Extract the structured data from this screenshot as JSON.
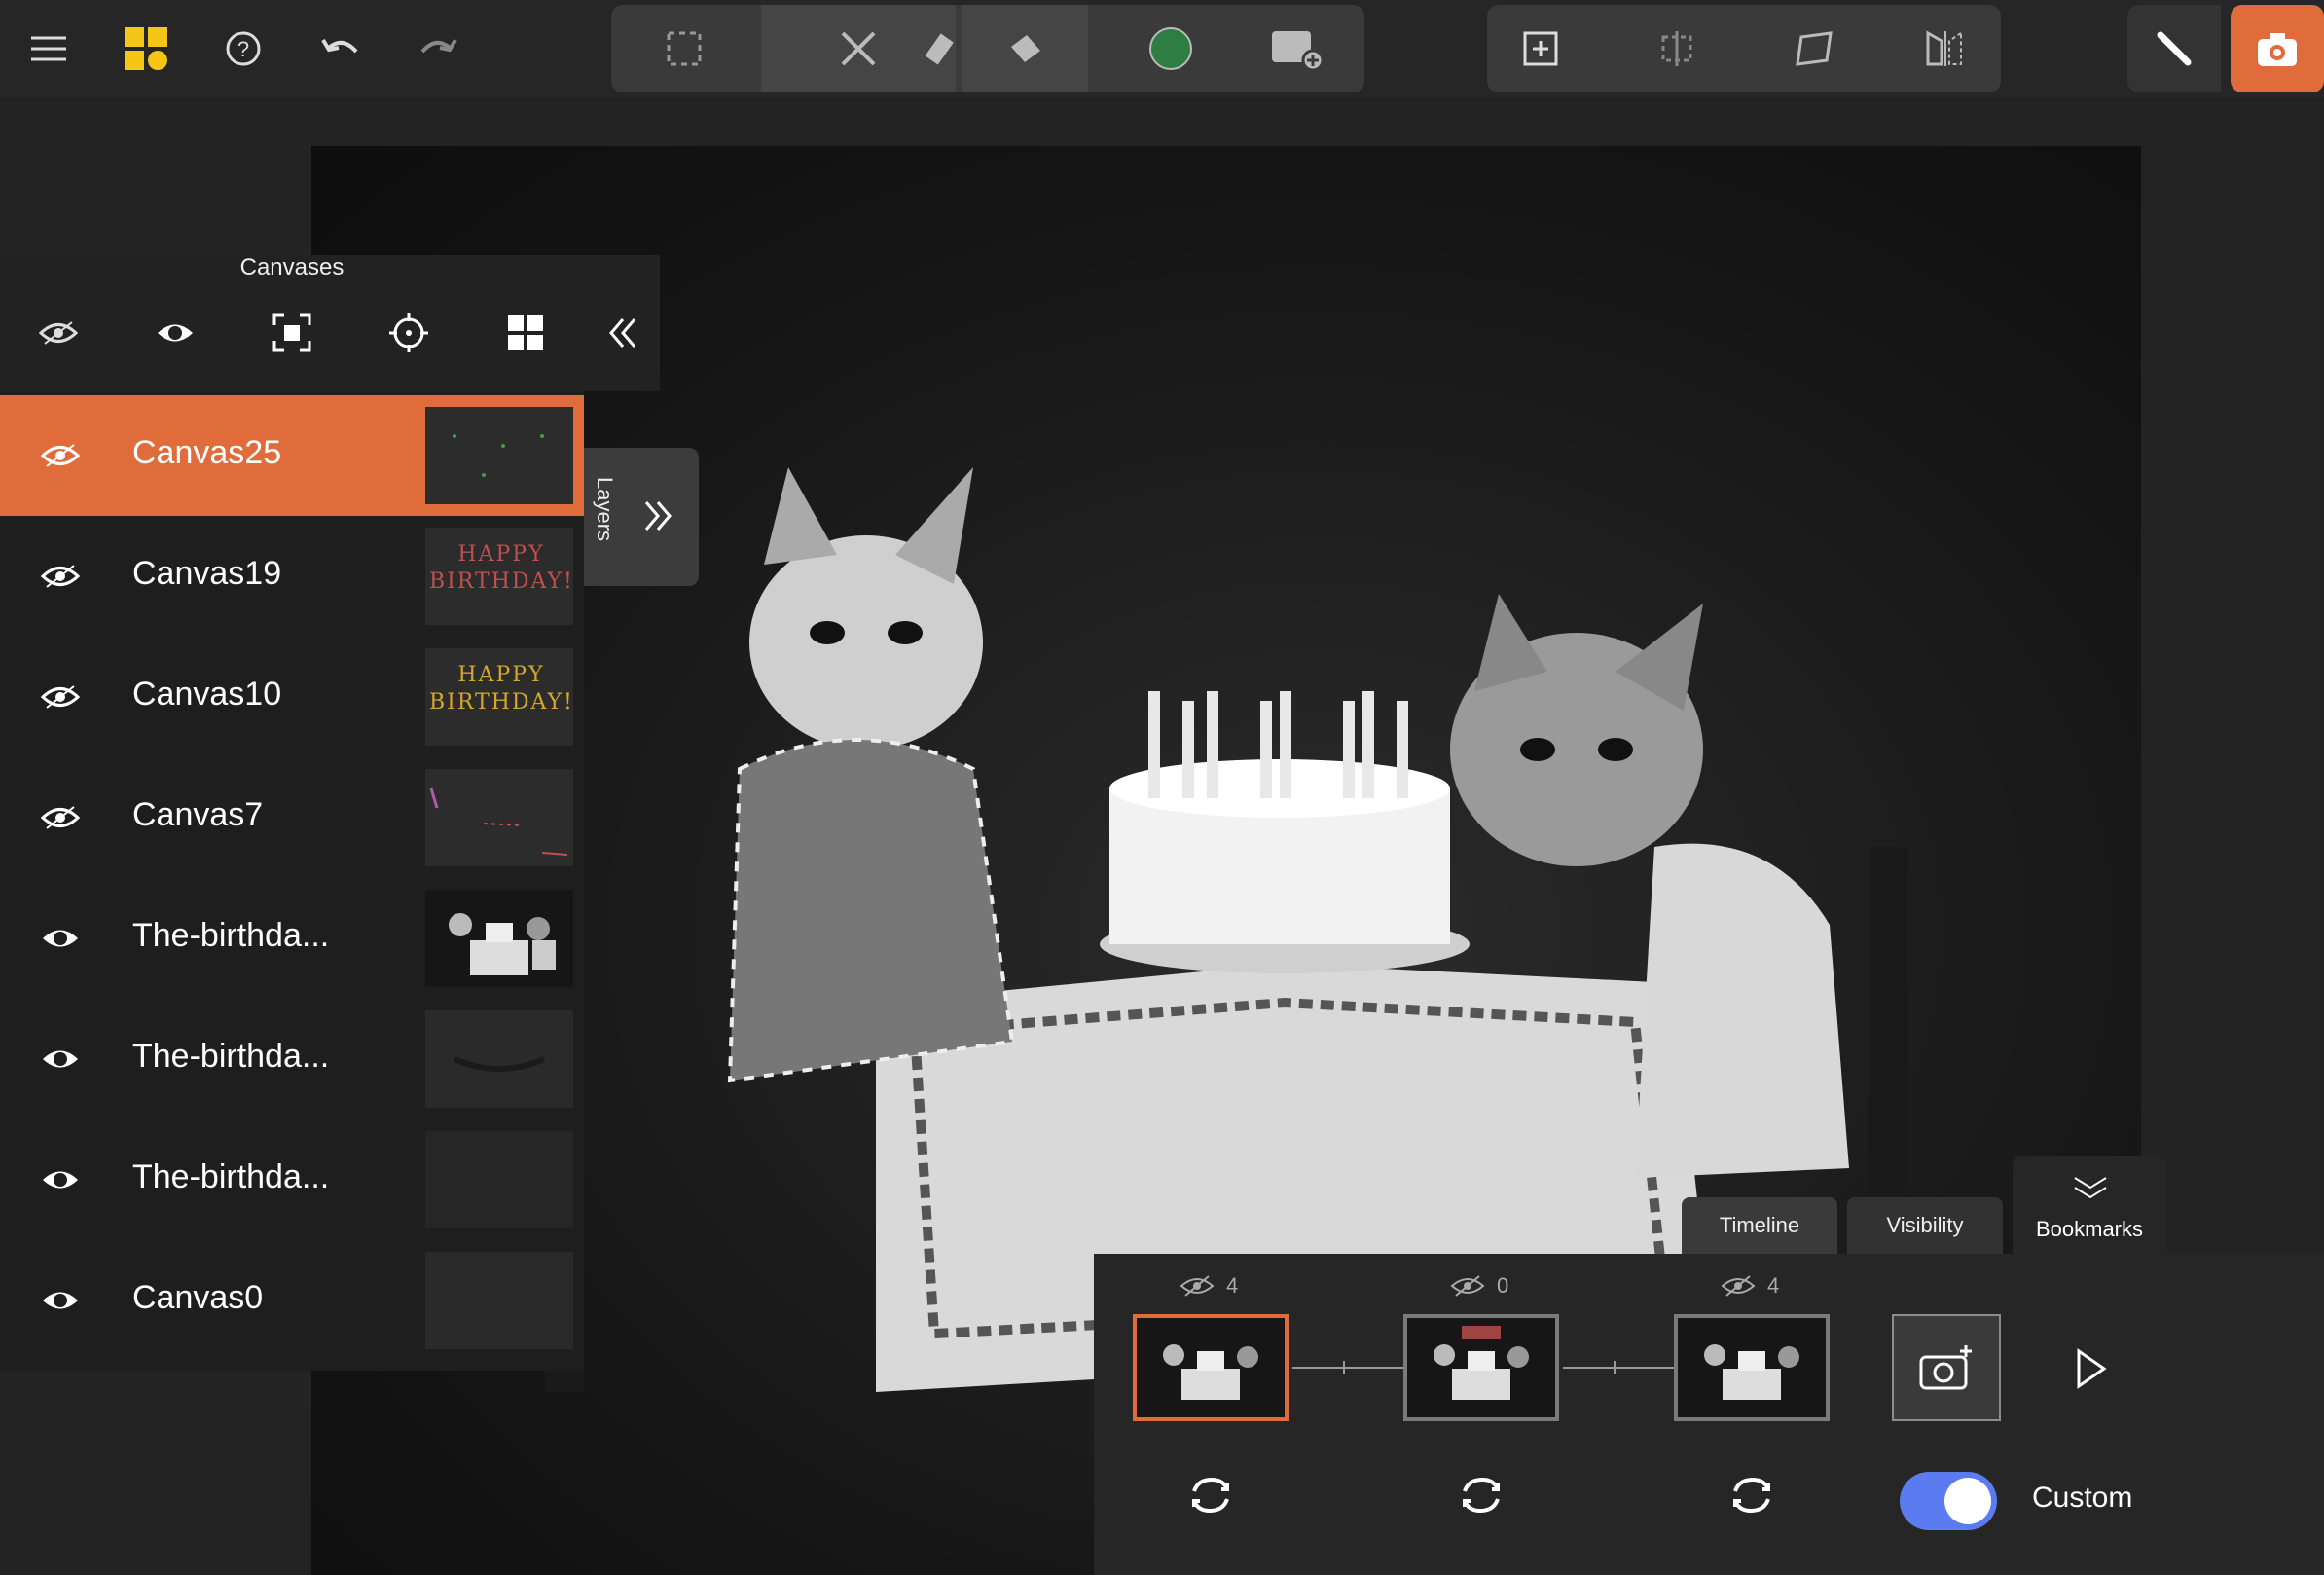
{
  "topbar": {
    "left_icons": [
      "menu-icon",
      "app-logo-icon",
      "help-icon",
      "undo-icon",
      "redo-icon"
    ],
    "tools": [
      "selection-icon",
      "brush-icon",
      "eraser-icon",
      "fill-bucket-icon",
      "color-swatch",
      "add-image-icon"
    ],
    "canvas_tools": [
      "add-canvas-icon",
      "align-icon",
      "transform-icon",
      "flip-icon"
    ],
    "right": [
      "draw-mode-icon",
      "camera-icon"
    ],
    "accent_color": "#e06c3c",
    "current_color": "#2e7d42"
  },
  "canvases": {
    "title": "Canvases",
    "toolbar": [
      "hide-all-icon",
      "show-all-icon",
      "fit-icon",
      "center-icon",
      "grid-icon",
      "collapse-icon"
    ],
    "layers": [
      {
        "name": "Canvas25",
        "selected": true,
        "visible": false,
        "thumb": "dots"
      },
      {
        "name": "Canvas19",
        "selected": false,
        "visible": false,
        "thumb": "text-red",
        "thumb_text": "HAPPY BIRTHDAY!"
      },
      {
        "name": "Canvas10",
        "selected": false,
        "visible": false,
        "thumb": "text-yellow",
        "thumb_text": "HAPPY BIRTHDAY!"
      },
      {
        "name": "Canvas7",
        "selected": false,
        "visible": false,
        "thumb": "scribble"
      },
      {
        "name": "The-birthda...",
        "selected": false,
        "visible": true,
        "thumb": "photo"
      },
      {
        "name": "The-birthda...",
        "selected": false,
        "visible": true,
        "thumb": "dark-1"
      },
      {
        "name": "The-birthda...",
        "selected": false,
        "visible": true,
        "thumb": "dark-2"
      },
      {
        "name": "Canvas0",
        "selected": false,
        "visible": true,
        "thumb": "empty"
      }
    ]
  },
  "layers_tab": {
    "label": "Layers"
  },
  "timeline": {
    "tabs": [
      "Timeline",
      "Visibility"
    ],
    "active_tab": "Timeline",
    "bookmarks_label": "Bookmarks",
    "frames": [
      {
        "count": "4",
        "active": true
      },
      {
        "count": "0",
        "active": false
      },
      {
        "count": "4",
        "active": false
      }
    ],
    "toggle_on": true,
    "toggle_label": "Custom"
  }
}
